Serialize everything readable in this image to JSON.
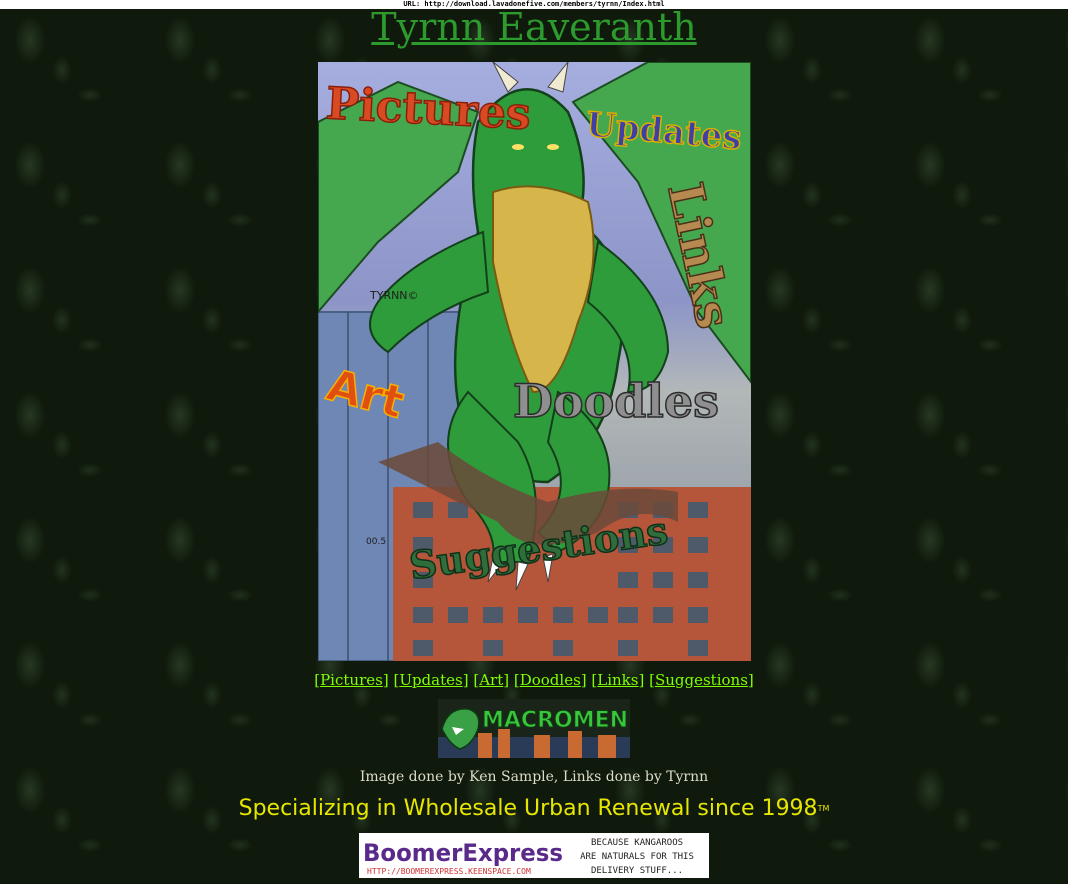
{
  "url_bar": {
    "text": "URL: http://download.lavadonefive.com/members/tyrnn/Index.html"
  },
  "header": {
    "title": "Tyrnn Eaveranth"
  },
  "main_image": {
    "labels": [
      "Pictures",
      "Updates",
      "Links",
      "Art",
      "Doodles",
      "Suggestions"
    ],
    "signature": "TYRNN©",
    "artist_mark": "00.5",
    "colors": {
      "dragon": "#2f9c3c",
      "belly": "#d6b64a",
      "building": "#b5553a"
    }
  },
  "nav": {
    "links": [
      {
        "label": "Pictures"
      },
      {
        "label": "Updates"
      },
      {
        "label": "Art"
      },
      {
        "label": "Doodles"
      },
      {
        "label": "Links"
      },
      {
        "label": "Suggestions"
      }
    ]
  },
  "macromenu_banner": {
    "text": "MACROMENU"
  },
  "credit": {
    "text": "Image done by Ken Sample, Links done by Tyrnn"
  },
  "tagline": {
    "text": "Specializing in Wholesale Urban Renewal since 1998",
    "mark": "TM"
  },
  "boomer_banner": {
    "logo": "BoomerExpress",
    "url": "HTTP://BOOMEREXPRESS.KEENSPACE.COM",
    "slogan_lines": [
      "BECAUSE KANGAROOS",
      "ARE NATURALS FOR THIS",
      "DELIVERY STUFF..."
    ]
  },
  "colors": {
    "background": "#0f1a0c",
    "title": "#2c9a2c",
    "nav_link": "#7fff00",
    "tagline": "#e6e600"
  }
}
